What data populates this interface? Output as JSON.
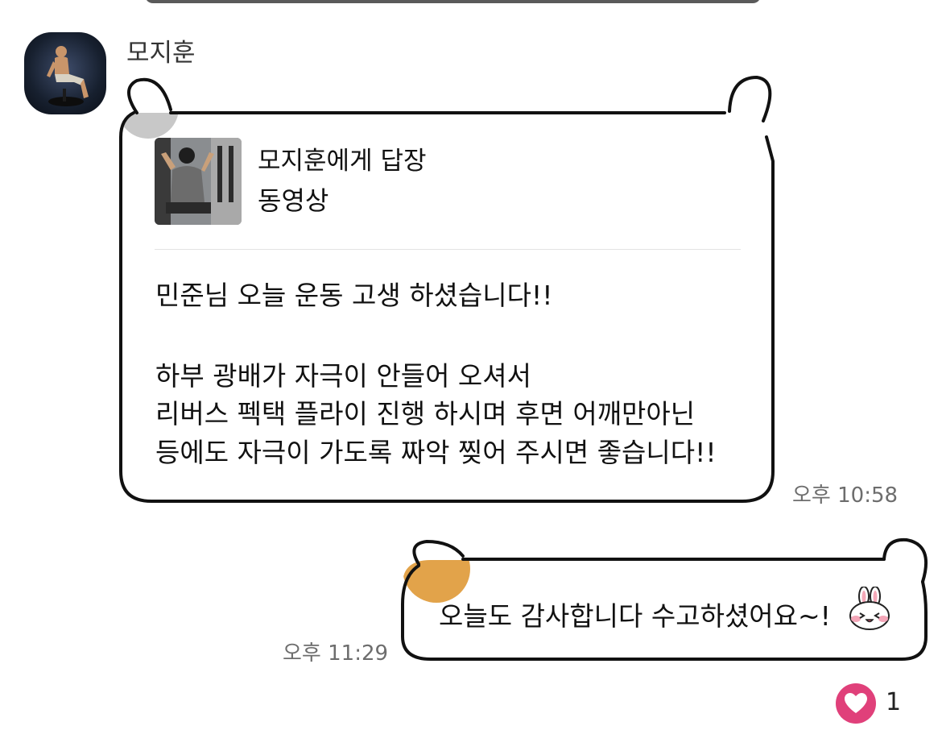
{
  "incoming": {
    "sender": "모지훈",
    "reply": {
      "title": "모지훈에게 답장",
      "type": "동영상"
    },
    "lines": [
      "민준님 오늘 운동 고생 하셨습니다!!",
      "하부 광배가 자극이 안들어 오셔서",
      "리버스 펙택 플라이 진행 하시며 후면 어깨만아닌",
      "등에도 자극이 가도록 짜악 찢어 주시면 좋습니다!!"
    ],
    "time": "오후 10:58"
  },
  "outgoing": {
    "text": "오늘도 감사합니다 수고하셨어요~!",
    "time": "오후 11:29"
  },
  "reaction": {
    "icon": "heart-icon",
    "count": "1",
    "color": "#e0407a"
  },
  "colors": {
    "incoming_ear": "#c8c8c8",
    "outgoing_ear": "#e2a34a",
    "bubble_border": "#111111"
  }
}
